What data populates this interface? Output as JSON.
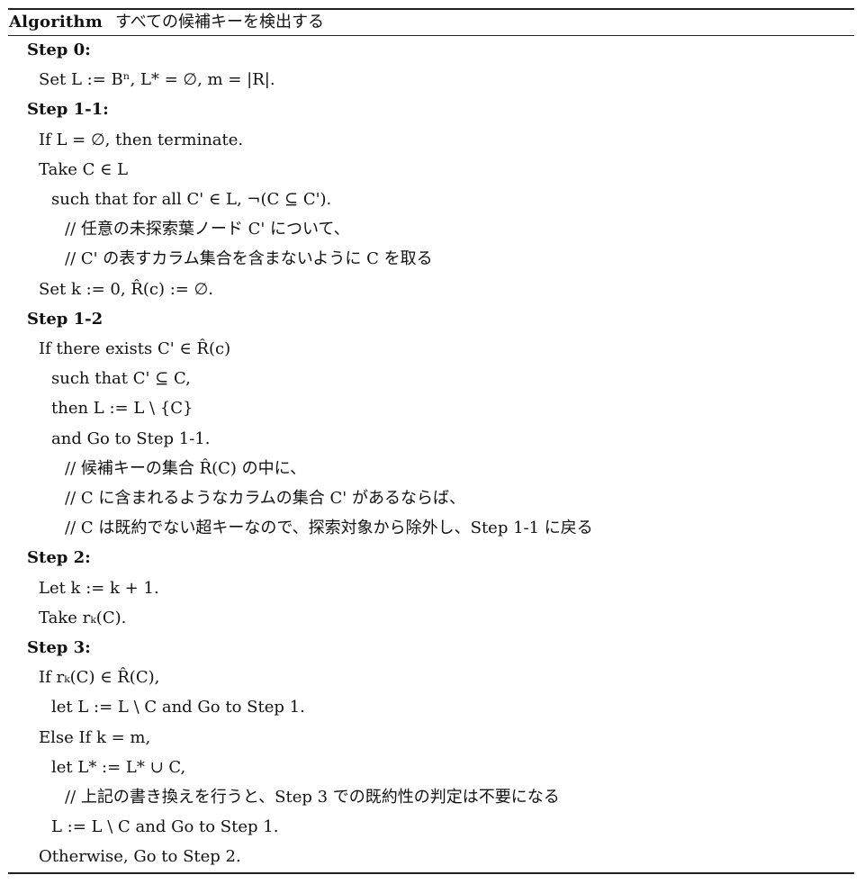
{
  "algorithm": {
    "header_label": "Algorithm",
    "header_title": "すべての候補キーを検出する",
    "lines": [
      {
        "level": "ind0",
        "kind": "step",
        "text": "Step 0:"
      },
      {
        "level": "ind1",
        "kind": "body",
        "text": "Set L := Bⁿ, L* = ∅, m = |R|."
      },
      {
        "level": "ind0",
        "kind": "step",
        "text": "Step 1-1:"
      },
      {
        "level": "ind1",
        "kind": "body",
        "text": "If L = ∅, then terminate."
      },
      {
        "level": "ind1",
        "kind": "body",
        "text": "Take C ∈ L"
      },
      {
        "level": "ind2",
        "kind": "body",
        "text": "such that for all C' ∈ L, ¬(C ⊆ C')."
      },
      {
        "level": "ind3",
        "kind": "comment",
        "text": "// 任意の未探索葉ノード C' について、"
      },
      {
        "level": "ind3",
        "kind": "comment",
        "text": "// C' の表すカラム集合を含まないように C を取る"
      },
      {
        "level": "ind1",
        "kind": "body",
        "text": "Set k := 0, R̂(c) := ∅."
      },
      {
        "level": "ind0",
        "kind": "step",
        "text": "Step 1-2"
      },
      {
        "level": "ind1",
        "kind": "body",
        "text": "If there exists C' ∈ R̂(c)"
      },
      {
        "level": "ind2",
        "kind": "body",
        "text": "such that C' ⊆ C,"
      },
      {
        "level": "ind2",
        "kind": "body",
        "text": "then L := L \\ {C}"
      },
      {
        "level": "ind2",
        "kind": "body",
        "text": "and Go to Step 1-1."
      },
      {
        "level": "ind3",
        "kind": "comment",
        "text": "// 候補キーの集合 R̂(C) の中に、"
      },
      {
        "level": "ind3",
        "kind": "comment",
        "text": "// C に含まれるようなカラムの集合 C' があるならば、"
      },
      {
        "level": "ind3",
        "kind": "comment",
        "text": "// C は既約でない超キーなので、探索対象から除外し、Step 1-1 に戻る"
      },
      {
        "level": "ind0",
        "kind": "step",
        "text": "Step 2:"
      },
      {
        "level": "ind1",
        "kind": "body",
        "text": "Let k := k + 1."
      },
      {
        "level": "ind1",
        "kind": "body",
        "text": "Take rₖ(C)."
      },
      {
        "level": "ind0",
        "kind": "step",
        "text": "Step 3:"
      },
      {
        "level": "ind1",
        "kind": "body",
        "text": "If rₖ(C) ∈ R̂(C),"
      },
      {
        "level": "ind2",
        "kind": "body",
        "text": "let L := L \\ C and Go to Step 1."
      },
      {
        "level": "ind1",
        "kind": "body",
        "text": "Else If k = m,"
      },
      {
        "level": "ind2",
        "kind": "body",
        "text": "let L* := L* ∪ C,"
      },
      {
        "level": "ind3",
        "kind": "comment",
        "text": "// 上記の書き換えを行うと、Step 3 での既約性の判定は不要になる"
      },
      {
        "level": "ind2",
        "kind": "body",
        "text": "L := L \\ C and Go to Step 1."
      },
      {
        "level": "ind1",
        "kind": "body",
        "text": "Otherwise, Go to Step 2."
      }
    ]
  }
}
